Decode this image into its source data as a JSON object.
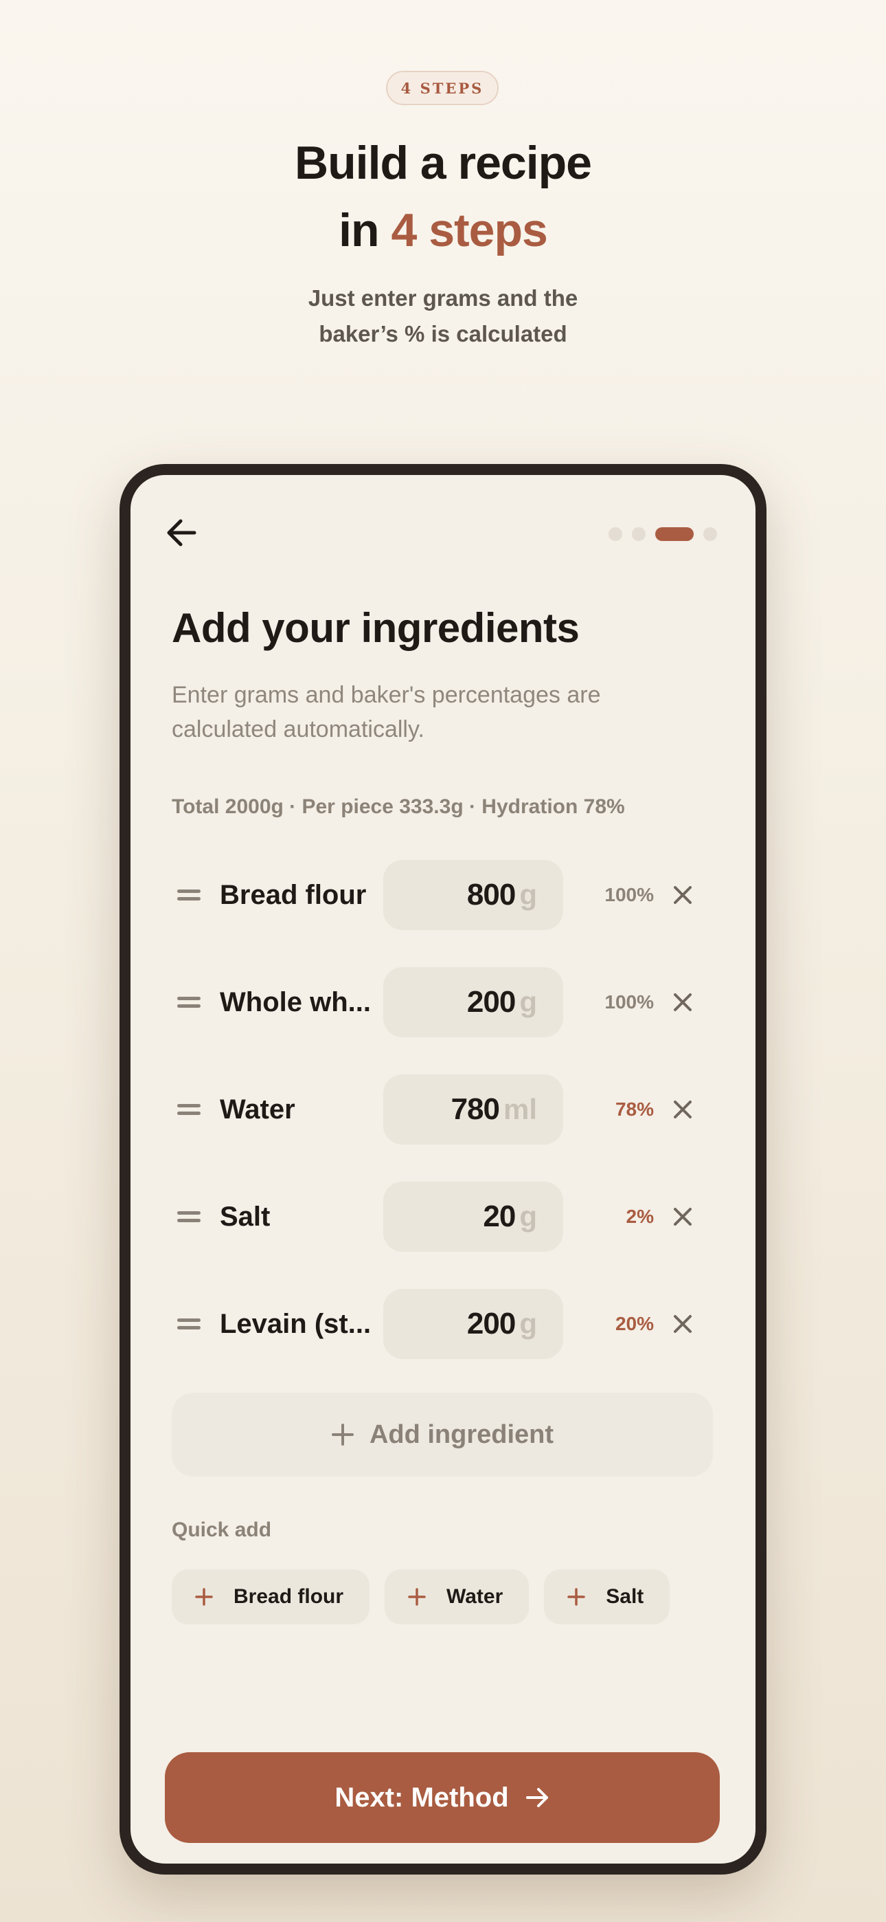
{
  "header": {
    "badge": "4 STEPS",
    "title_line1": "Build a recipe",
    "title_line2_prefix": "in ",
    "title_line2_accent": "4 steps",
    "subtitle_line1": "Just enter grams and the",
    "subtitle_line2": "baker’s % is calculated"
  },
  "colors": {
    "accent": "#a95c41",
    "background": "#f4efe7",
    "phone_frame": "#2b2420"
  },
  "progress": {
    "total_steps": 4,
    "current_step": 3
  },
  "screen": {
    "title": "Add your ingredients",
    "subtitle": "Enter grams and baker's percentages are calculated automatically.",
    "summary": "Total 2000g · Per piece 333.3g · Hydration 78%"
  },
  "ingredients": [
    {
      "name": "Bread flour",
      "amount": "800",
      "unit": "g",
      "percent": "100%",
      "accent": false
    },
    {
      "name": "Whole wh...",
      "amount": "200",
      "unit": "g",
      "percent": "100%",
      "accent": false
    },
    {
      "name": "Water",
      "amount": "780",
      "unit": "ml",
      "percent": "78%",
      "accent": true
    },
    {
      "name": "Salt",
      "amount": "20",
      "unit": "g",
      "percent": "2%",
      "accent": true
    },
    {
      "name": "Levain (st...",
      "amount": "200",
      "unit": "g",
      "percent": "20%",
      "accent": true
    }
  ],
  "add_ingredient_label": "Add ingredient",
  "quick_add": {
    "label": "Quick add",
    "chips": [
      "Bread flour",
      "Water",
      "Salt"
    ]
  },
  "next_button": {
    "label": "Next: Method"
  },
  "icons": {
    "back": "arrow-left-icon",
    "drag": "drag-handle-icon",
    "remove": "close-icon",
    "add": "plus-icon",
    "next": "arrow-right-icon"
  }
}
